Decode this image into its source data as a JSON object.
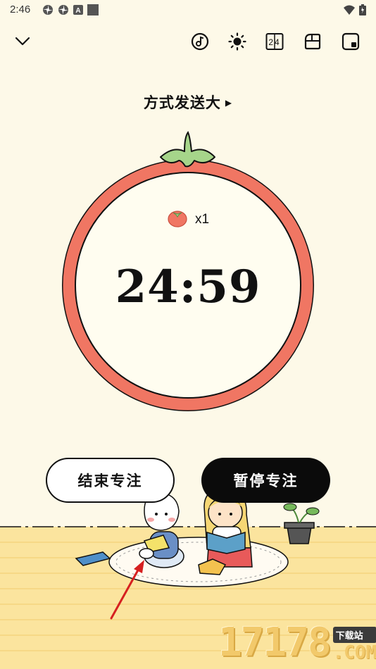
{
  "status": {
    "time": "2:46",
    "notif_icons": [
      "pinwheel-icon",
      "pinwheel-icon",
      "a-box-icon",
      "square-icon"
    ],
    "right_icons": [
      "wifi-icon",
      "battery-icon"
    ]
  },
  "toolbar": {
    "collapse_icon": "chevron-down-icon",
    "icons": [
      "music-icon",
      "brightness-icon",
      "flip-clock-icon",
      "layout-icon",
      "floating-window-icon"
    ],
    "flip_clock_text": "24"
  },
  "task": {
    "name": "方式发送大",
    "arrow": "▶"
  },
  "timer": {
    "tomato_count": "x1",
    "remaining": "24:59",
    "progress_fraction": 0.0007,
    "ring_color": "#f07663",
    "leaf_color": "#a6d58a"
  },
  "actions": {
    "end_label": "结束专注",
    "pause_label": "暂停专注"
  },
  "watermark": {
    "number": "17178",
    "tag": "下载站",
    "com": ".COM"
  }
}
